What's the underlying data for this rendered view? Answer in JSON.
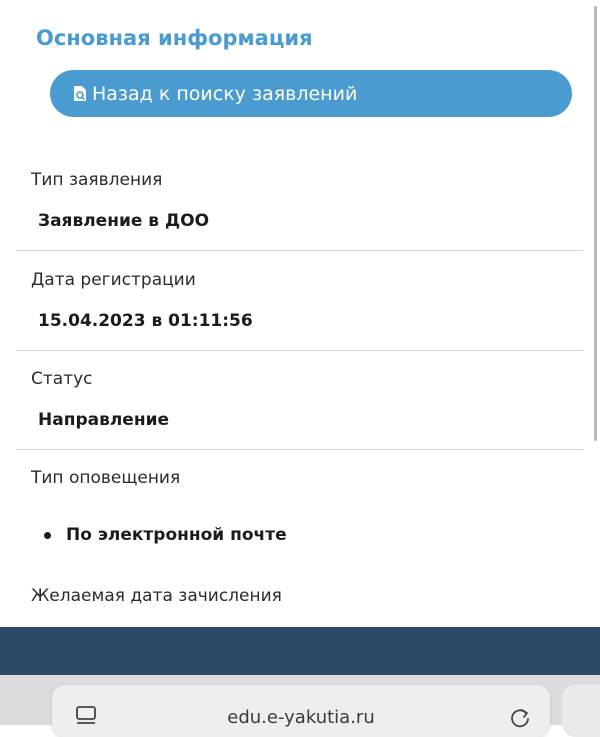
{
  "header": {
    "title": "Основная информация"
  },
  "back_button": {
    "label": "Назад к поиску заявлений",
    "icon": "search-document-icon"
  },
  "fields": [
    {
      "label": "Тип заявления",
      "value": "Заявление в ДОО"
    },
    {
      "label": "Дата регистрации",
      "value": "15.04.2023 в 01:11:56"
    },
    {
      "label": "Статус",
      "value": "Направление"
    }
  ],
  "notification": {
    "label": "Тип оповещения",
    "items": [
      "По электронной почте"
    ]
  },
  "desired_date": {
    "label": "Желаемая дата зачисления"
  },
  "browser": {
    "url": "edu.e-yakutia.ru"
  },
  "colors": {
    "accent": "#4a9bcf",
    "footer": "#2c4a66"
  }
}
